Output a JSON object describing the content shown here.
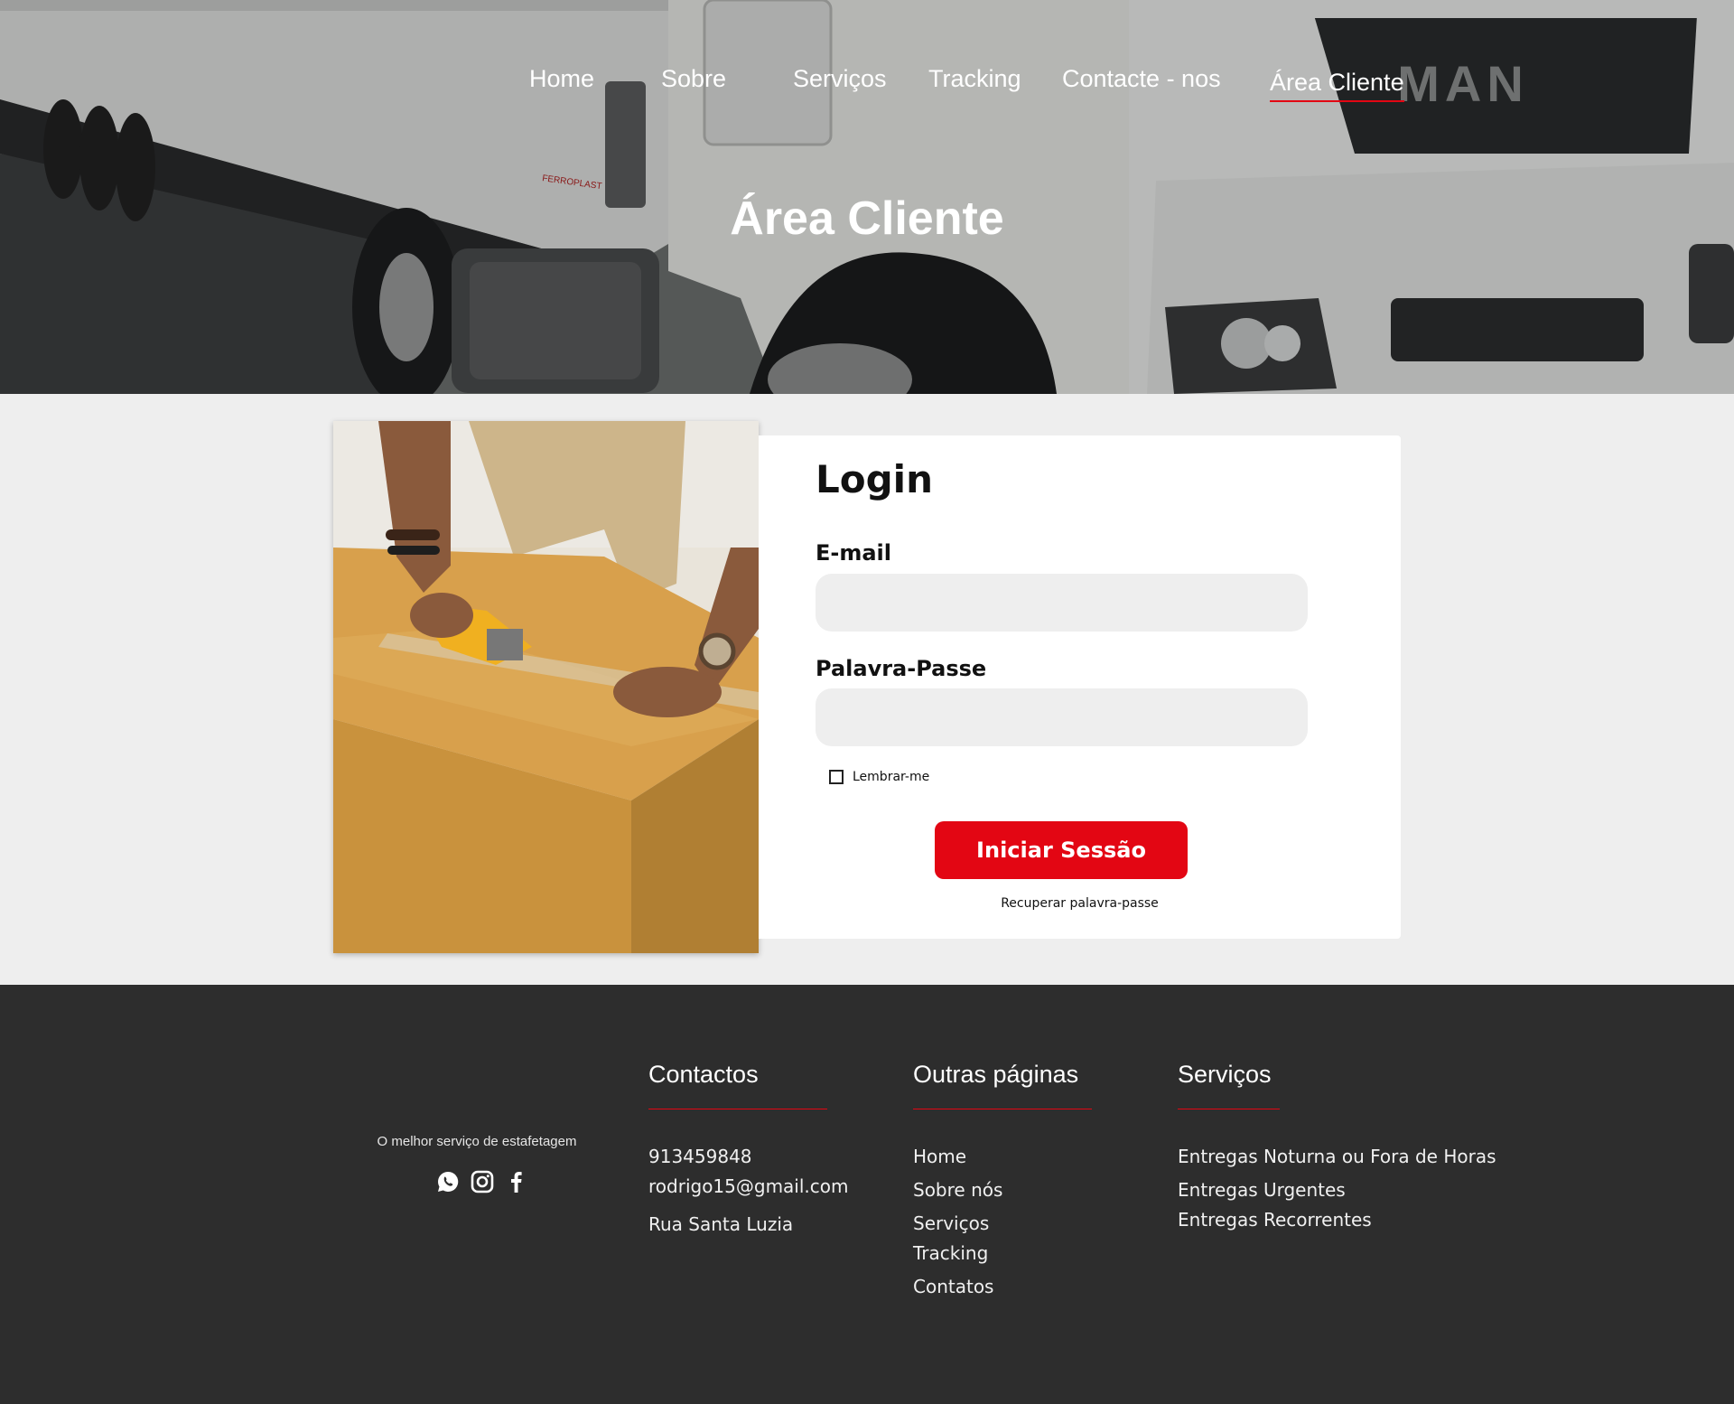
{
  "nav": {
    "items": [
      {
        "label": "Home"
      },
      {
        "label": "Sobre"
      },
      {
        "label": "Serviços"
      },
      {
        "label": "Tracking"
      },
      {
        "label": "Contacte - nos"
      },
      {
        "label": "Área Cliente",
        "active": true
      }
    ]
  },
  "hero": {
    "title": "Área Cliente",
    "truck_badge": "MAN",
    "trailer_logo": "FERROPLAST",
    "image": "white-truck-photo"
  },
  "login": {
    "title": "Login",
    "email_label": "E-mail",
    "email_value": "",
    "password_label": "Palavra-Passe",
    "password_value": "",
    "remember_label": "Lembrar-me",
    "remember_checked": false,
    "submit_label": "Iniciar Sessão",
    "recover_label": "Recuperar palavra-passe",
    "image": "person-taping-cardboard-box"
  },
  "footer": {
    "tagline": "O melhor serviço de estafetagem",
    "social_icons": [
      "whatsapp-icon",
      "instagram-icon",
      "facebook-icon"
    ],
    "contacts": {
      "title": "Contactos",
      "phone": "913459848",
      "email": "rodrigo15@gmail.com",
      "address": "Rua Santa Luzia"
    },
    "pages": {
      "title": "Outras páginas",
      "items": [
        "Home",
        "Sobre nós",
        "Serviços",
        "Tracking",
        "Contatos"
      ]
    },
    "services": {
      "title": "Serviços",
      "items": [
        "Entregas Noturna ou Fora de Horas",
        "Entregas Urgentes",
        "Entregas Recorrentes"
      ]
    }
  },
  "colors": {
    "accent": "#e30613",
    "footer_bg": "#2d2d2d",
    "page_bg": "#eeeeee"
  }
}
